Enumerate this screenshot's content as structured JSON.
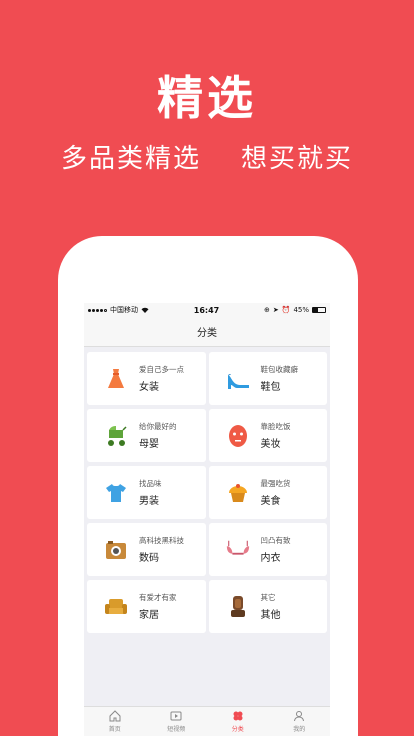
{
  "hero": {
    "title": "精选",
    "subtitle_left": "多品类精选",
    "subtitle_right": "想买就买"
  },
  "statusbar": {
    "carrier": "中国移动",
    "time": "16:47",
    "battery": "45%"
  },
  "nav": {
    "title": "分类"
  },
  "categories": [
    {
      "sub": "爱自己多一点",
      "main": "女装",
      "icon": "dress-icon"
    },
    {
      "sub": "鞋包收藏癖",
      "main": "鞋包",
      "icon": "high-heel-icon"
    },
    {
      "sub": "给你最好的",
      "main": "母婴",
      "icon": "stroller-icon"
    },
    {
      "sub": "靠脸吃饭",
      "main": "美妆",
      "icon": "face-mask-icon"
    },
    {
      "sub": "找品味",
      "main": "男装",
      "icon": "tshirt-icon"
    },
    {
      "sub": "最强吃货",
      "main": "美食",
      "icon": "cupcake-icon"
    },
    {
      "sub": "高科技黑科技",
      "main": "数码",
      "icon": "camera-icon"
    },
    {
      "sub": "凹凸有致",
      "main": "内衣",
      "icon": "bra-icon"
    },
    {
      "sub": "有爱才有家",
      "main": "家居",
      "icon": "armchair-icon"
    },
    {
      "sub": "其它",
      "main": "其他",
      "icon": "car-seat-icon"
    }
  ],
  "tabs": [
    {
      "label": "首页",
      "icon": "home-icon"
    },
    {
      "label": "短视频",
      "icon": "video-icon"
    },
    {
      "label": "分类",
      "icon": "category-icon",
      "active": true
    },
    {
      "label": "我的",
      "icon": "user-icon"
    }
  ],
  "colors": {
    "accent": "#f04c52",
    "background": "#efeff4"
  }
}
